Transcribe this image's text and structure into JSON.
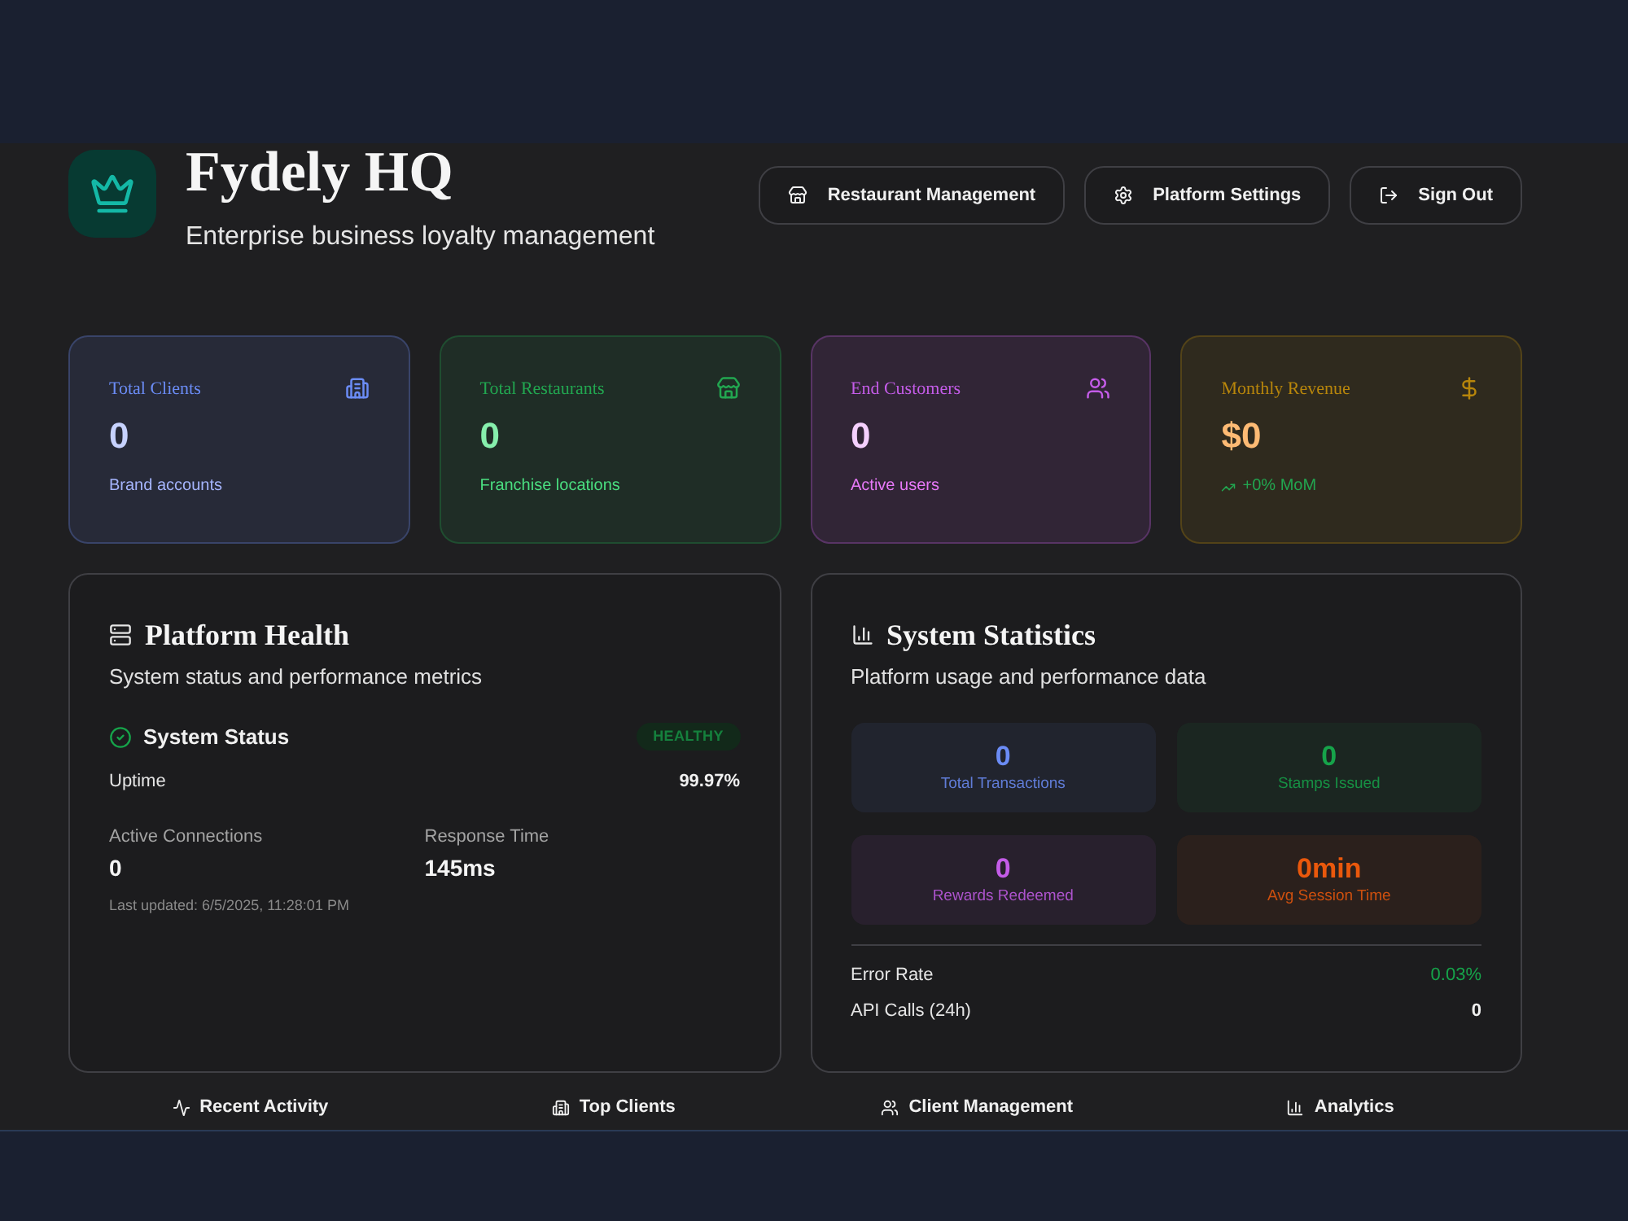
{
  "header": {
    "title": "Fydely HQ",
    "subtitle": "Enterprise business loyalty management"
  },
  "actions": [
    {
      "label": "Restaurant Management"
    },
    {
      "label": "Platform Settings"
    },
    {
      "label": "Sign Out"
    }
  ],
  "stat_cards": [
    {
      "title": "Total Clients",
      "value": "0",
      "caption": "Brand accounts",
      "color": "#6b8cf5",
      "kind": "plain"
    },
    {
      "title": "Total Restaurants",
      "value": "0",
      "caption": "Franchise locations",
      "color": "#22a650",
      "kind": "plain"
    },
    {
      "title": "End Customers",
      "value": "0",
      "caption": "Active users",
      "color": "#c45ce8",
      "kind": "plain"
    },
    {
      "title": "Monthly Revenue",
      "value": "$0",
      "caption": "+0% MoM",
      "color": "#b8860b",
      "kind": "trend"
    }
  ],
  "platform_health": {
    "title": "Platform Health",
    "subtitle": "System status and performance metrics",
    "status": {
      "label": "System Status",
      "badge": "HEALTHY"
    },
    "uptime": {
      "label": "Uptime",
      "value": "99.97%"
    },
    "metrics": [
      {
        "label": "Active Connections",
        "value": "0"
      },
      {
        "label": "Response Time",
        "value": "145ms"
      }
    ],
    "updated": "Last updated: 6/5/2025, 11:28:01 PM"
  },
  "system_statistics": {
    "title": "System Statistics",
    "subtitle": "Platform usage and performance data",
    "tiles": [
      {
        "value": "0",
        "label": "Total Transactions",
        "color": "#6b8cf5"
      },
      {
        "value": "0",
        "label": "Stamps Issued",
        "color": "#16a34a"
      },
      {
        "value": "0",
        "label": "Rewards Redeemed",
        "color": "#c45ce8"
      },
      {
        "value": "0min",
        "label": "Avg Session Time",
        "color": "#ea580c"
      }
    ],
    "rows": [
      {
        "label": "Error Rate",
        "value": "0.03%",
        "kind": "good"
      },
      {
        "label": "API Calls (24h)",
        "value": "0",
        "kind": "plain"
      }
    ]
  },
  "tabs": [
    {
      "label": "Recent Activity"
    },
    {
      "label": "Top Clients"
    },
    {
      "label": "Client Management"
    },
    {
      "label": "Analytics"
    }
  ]
}
